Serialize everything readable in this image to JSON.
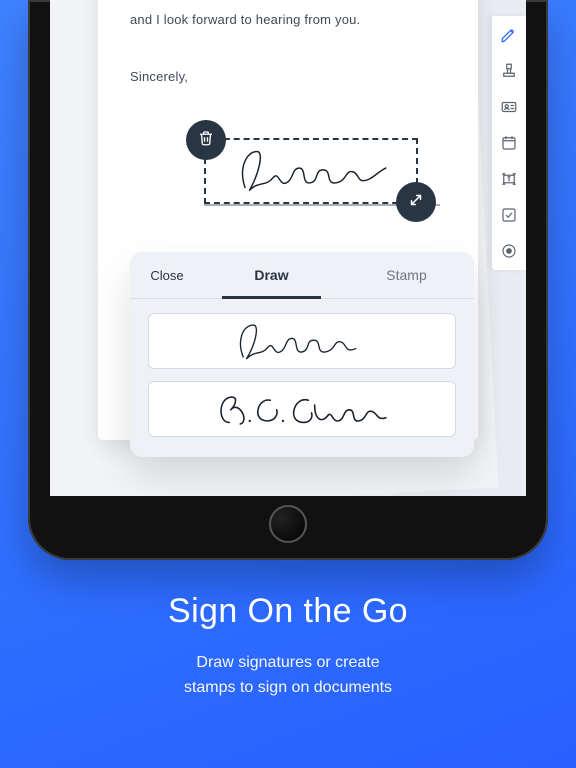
{
  "document": {
    "body_line": "and I look forward to hearing from you.",
    "closing": "Sincerely,"
  },
  "selection": {
    "signature_name": "James"
  },
  "toolbar": {
    "icons": [
      "pen",
      "stamp",
      "id-card",
      "calendar",
      "text-box",
      "checkbox",
      "record"
    ]
  },
  "signature_panel": {
    "close_label": "Close",
    "tabs": {
      "draw": "Draw",
      "stamp": "Stamp"
    },
    "items": [
      "James",
      "J. C. Charles"
    ]
  },
  "promo": {
    "title": "Sign On the Go",
    "subtitle_line1": "Draw signatures or create",
    "subtitle_line2": "stamps to sign on documents"
  }
}
